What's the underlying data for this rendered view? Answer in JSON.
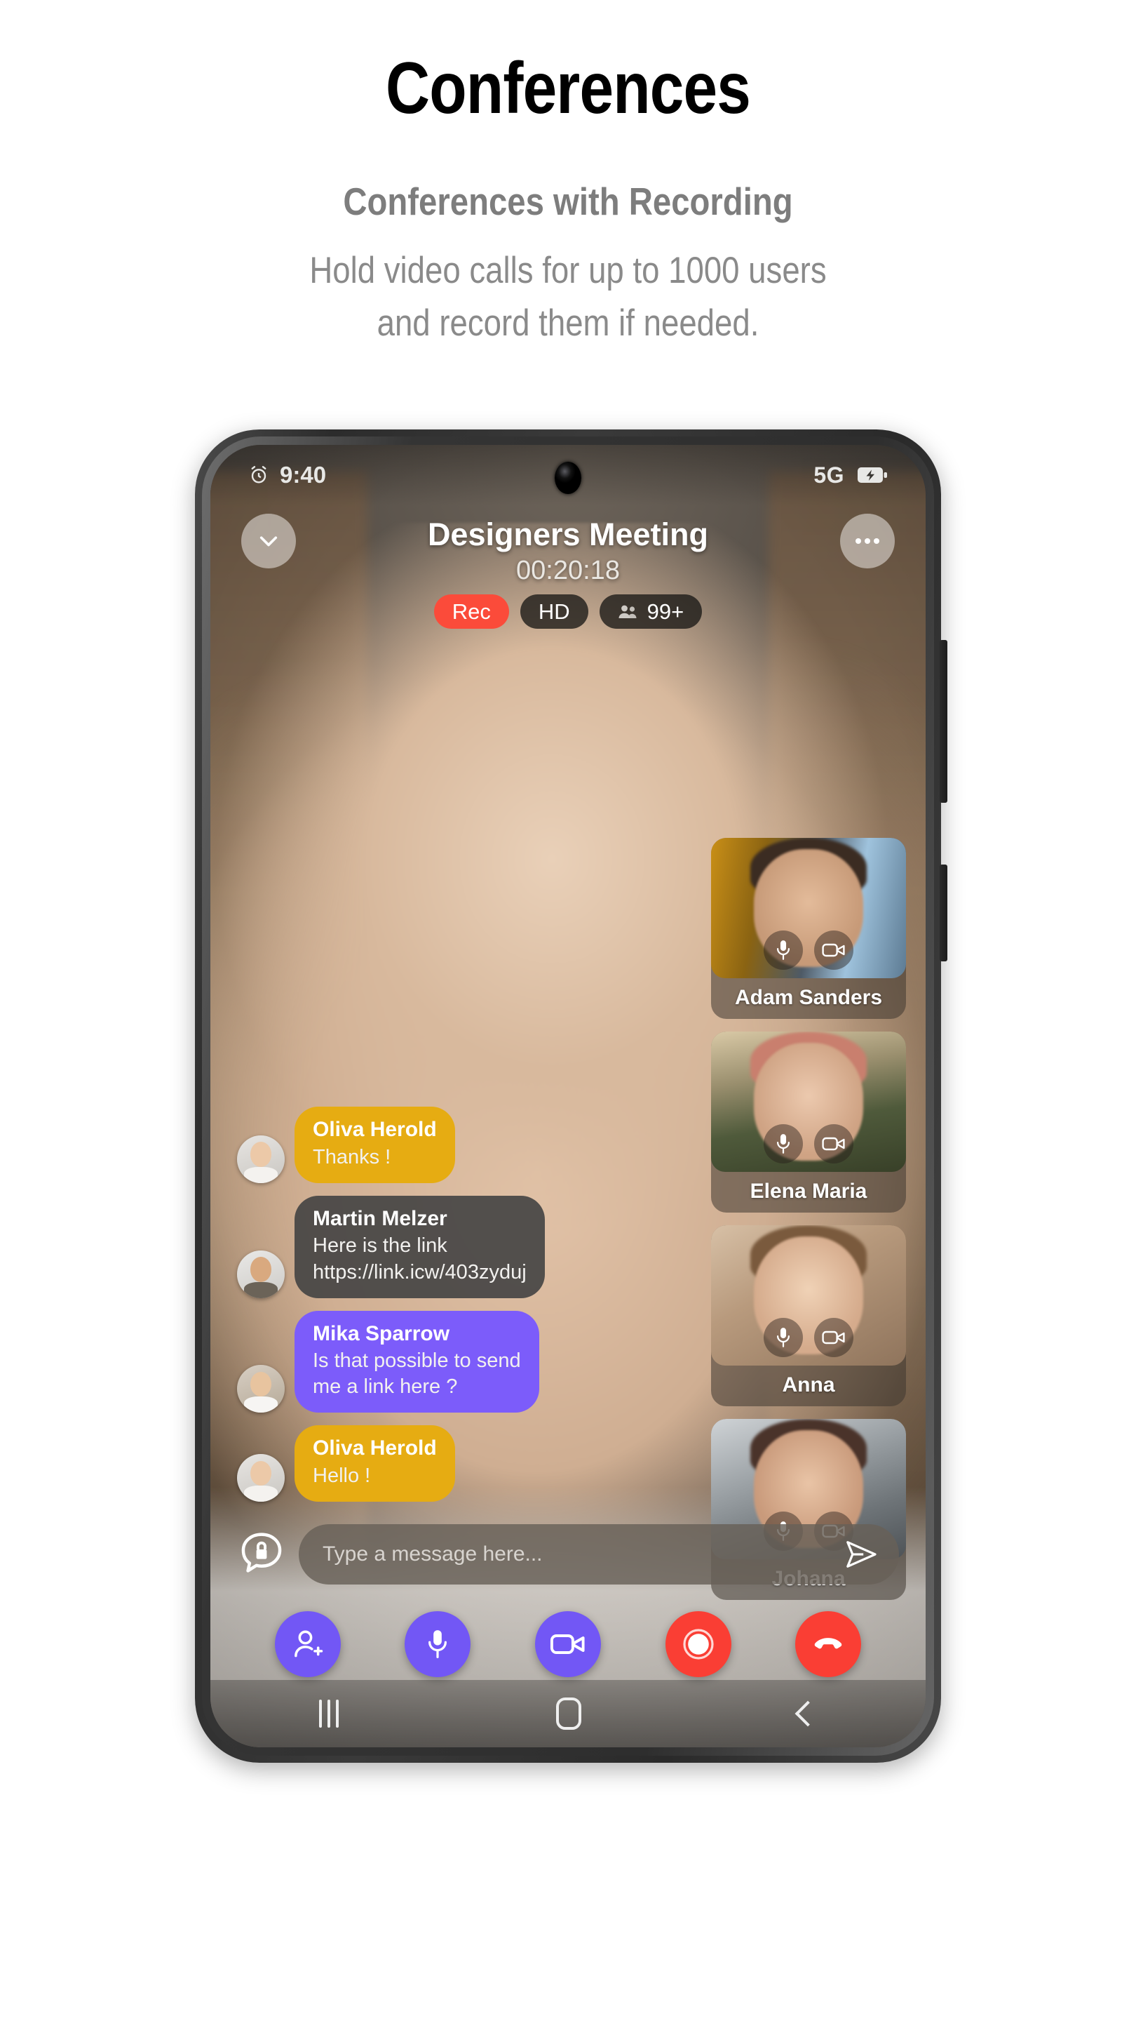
{
  "promo": {
    "title": "Conferences",
    "subtitle": "Conferences with Recording",
    "description_line1": "Hold video calls for up to 1000 users",
    "description_line2": "and record them if needed."
  },
  "status_bar": {
    "alarm_icon": "alarm-clock-icon",
    "time": "9:40",
    "network": "5G",
    "battery_icon": "battery-charging-icon"
  },
  "call_header": {
    "collapse_icon": "chevron-down-icon",
    "title": "Designers Meeting",
    "timer": "00:20:18",
    "more_icon": "more-horizontal-icon",
    "badges": [
      {
        "label": "Rec",
        "style": "rec",
        "icon": ""
      },
      {
        "label": "HD",
        "style": "dark",
        "icon": ""
      },
      {
        "label": "99+",
        "style": "dark",
        "icon": "people-icon"
      }
    ]
  },
  "participants": [
    {
      "name": "Adam Sanders",
      "mic_icon": "microphone-icon",
      "camera_icon": "video-camera-icon"
    },
    {
      "name": "Elena Maria",
      "mic_icon": "microphone-icon",
      "camera_icon": "video-camera-icon"
    },
    {
      "name": "Anna",
      "mic_icon": "microphone-icon",
      "camera_icon": "video-camera-icon"
    },
    {
      "name": "Johana",
      "mic_icon": "microphone-icon",
      "camera_icon": "video-camera-icon"
    }
  ],
  "chat": {
    "messages": [
      {
        "sender": "Oliva Herold",
        "text": "Thanks !",
        "style": "amber"
      },
      {
        "sender": "Martin Melzer",
        "text": "Here is the link\nhttps://link.icw/403zyduj",
        "style": "dark"
      },
      {
        "sender": "Mika Sparrow",
        "text": "Is that possible to send\nme a link here ?",
        "style": "purple"
      },
      {
        "sender": "Oliva Herold",
        "text": "Hello !",
        "style": "amber"
      }
    ]
  },
  "composer": {
    "secure_icon": "lock-chat-icon",
    "placeholder": "Type a message here...",
    "send_icon": "send-icon"
  },
  "controls": [
    {
      "name": "add-participant",
      "icon": "add-person-icon",
      "color": "purple"
    },
    {
      "name": "mute-microphone",
      "icon": "microphone-icon",
      "color": "purple"
    },
    {
      "name": "toggle-camera",
      "icon": "video-camera-icon",
      "color": "purple"
    },
    {
      "name": "record",
      "icon": "record-circle-icon",
      "color": "red"
    },
    {
      "name": "end-call",
      "icon": "end-call-icon",
      "color": "red"
    }
  ],
  "nav_bar": {
    "recents_icon": "recents-icon",
    "home_icon": "home-icon",
    "back_icon": "back-icon"
  },
  "colors": {
    "rec_red": "#fb4b3a",
    "amber": "#e6ac12",
    "purple": "#7c5cfa",
    "control_purple": "#7257f5",
    "control_red": "#fa3e34",
    "title_black": "#000000",
    "subtitle_gray": "#7d7d7d"
  }
}
